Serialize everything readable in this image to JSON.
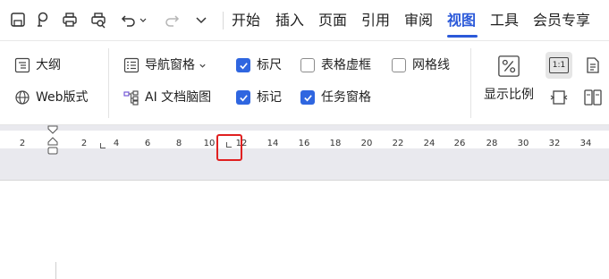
{
  "toolbar": {
    "tabs": [
      "开始",
      "插入",
      "页面",
      "引用",
      "审阅",
      "视图",
      "工具",
      "会员专享"
    ],
    "active_tab": "视图",
    "accent_color": "#2b59d9",
    "quick_icons": [
      "save-icon",
      "format-painter-icon",
      "print-icon",
      "print-preview-icon",
      "undo-icon",
      "redo-icon",
      "more-chevron-icon"
    ]
  },
  "ribbon": {
    "outline": "大纲",
    "web_layout": "Web版式",
    "nav_pane": "导航窗格",
    "ai_mindmap": "AI 文档脑图",
    "ruler": "标尺",
    "marks": "标记",
    "table_gridlines": "表格虚框",
    "task_pane": "任务窗格",
    "gridlines": "网格线",
    "zoom": "显示比例",
    "one_to_one": "1:1",
    "checkboxes": {
      "ruler": true,
      "marks": true,
      "table_gridlines": false,
      "task_pane": true,
      "gridlines": false
    }
  },
  "ruler": {
    "numbers": [
      "2",
      "2",
      "4",
      "6",
      "8",
      "10",
      "12",
      "14",
      "16",
      "18",
      "20",
      "22",
      "24",
      "26",
      "28",
      "30",
      "32",
      "34"
    ]
  }
}
